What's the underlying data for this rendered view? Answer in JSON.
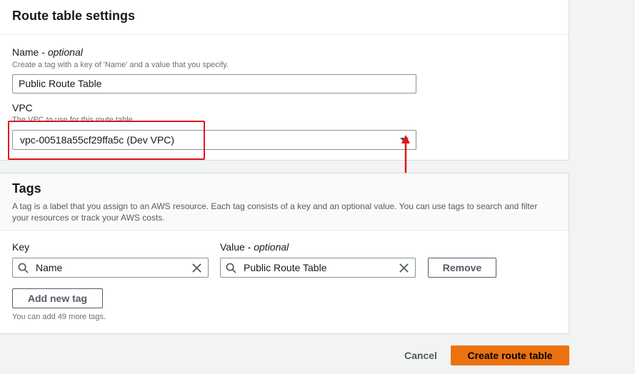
{
  "route_settings": {
    "title": "Route table settings",
    "name_label": "Name",
    "name_optional": "optional",
    "name_desc": "Create a tag with a key of 'Name' and a value that you specify.",
    "name_value": "Public Route Table",
    "vpc_label": "VPC",
    "vpc_desc": "The VPC to use for this route table.",
    "vpc_value": "vpc-00518a55cf29ffa5c (Dev VPC)",
    "vpc_icon": "caret-down-icon"
  },
  "annotation": {
    "highlight_color": "#e3151a"
  },
  "tags": {
    "title": "Tags",
    "description": "A tag is a label that you assign to an AWS resource. Each tag consists of a key and an optional value. You can use tags to search and filter your resources or track your AWS costs.",
    "key_label": "Key",
    "value_label": "Value",
    "value_optional": "optional",
    "rows": [
      {
        "key": "Name",
        "value": "Public Route Table"
      }
    ],
    "remove_label": "Remove",
    "add_label": "Add new tag",
    "remaining_note": "You can add 49 more tags."
  },
  "footer": {
    "cancel_label": "Cancel",
    "create_label": "Create route table",
    "primary_color": "#ec7211"
  }
}
